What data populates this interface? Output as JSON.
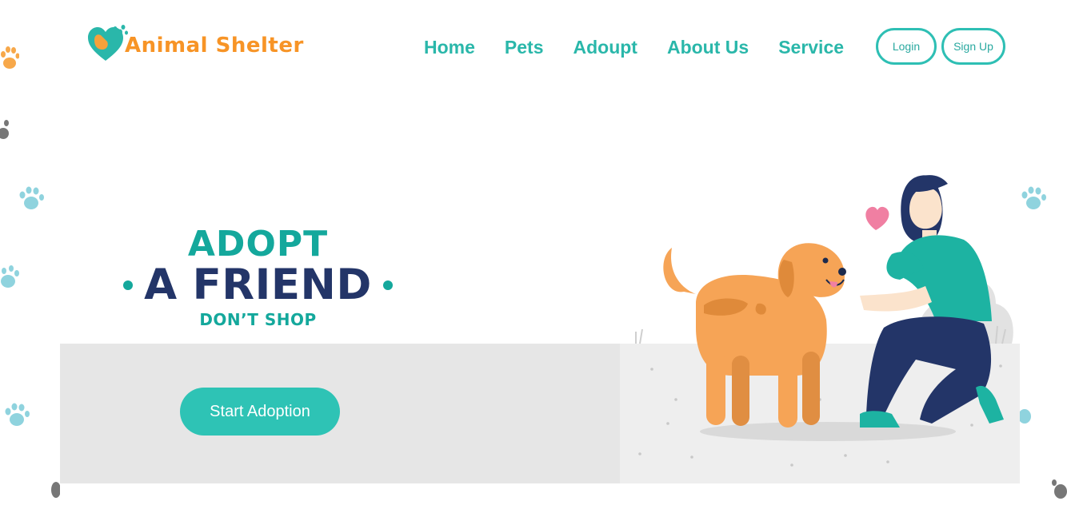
{
  "brand": {
    "name": "Animal Shelter",
    "text_color": "#f79426",
    "accent_color": "#2ab7aa"
  },
  "nav": {
    "items": [
      {
        "label": "Home"
      },
      {
        "label": "Pets"
      },
      {
        "label": "Adoupt"
      },
      {
        "label": "About Us"
      },
      {
        "label": "Service"
      }
    ]
  },
  "auth": {
    "login_label": "Login",
    "signup_label": "Sign Up"
  },
  "hero": {
    "line1": "ADOPT",
    "line2": "A FRIEND",
    "line3": "DON’T SHOP",
    "cta_label": "Start Adoption",
    "illustration": "woman-petting-dog-illustration"
  },
  "colors": {
    "teal": "#2ec3b5",
    "navy": "#233568",
    "band_gray": "#e6e6e6"
  }
}
